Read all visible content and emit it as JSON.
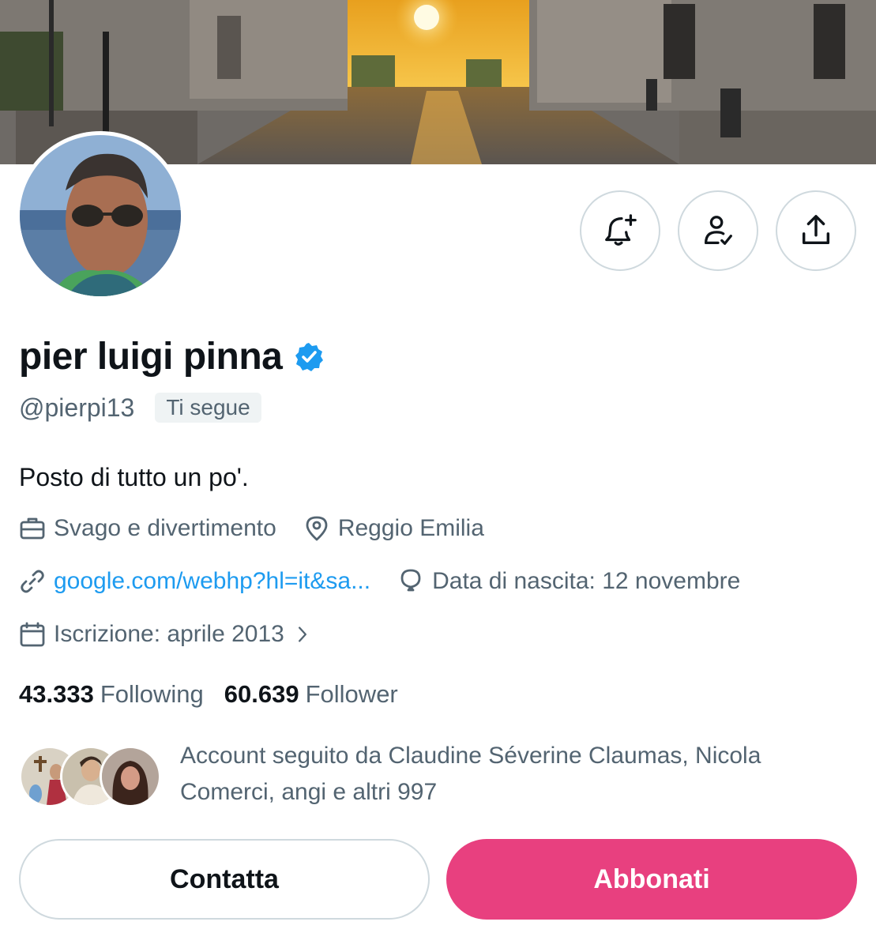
{
  "profile": {
    "display_name": "pier luigi pinna",
    "handle": "@pierpi13",
    "follows_you_badge": "Ti segue",
    "bio": "Posto di tutto un po'.",
    "category": "Svago e divertimento",
    "location": "Reggio Emilia",
    "website": "google.com/webhp?hl=it&sa...",
    "birthday": "Data di nascita: 12 novembre",
    "joined": "Iscrizione: aprile 2013"
  },
  "stats": {
    "following_count": "43.333",
    "following_label": "Following",
    "followers_count": "60.639",
    "followers_label": "Follower"
  },
  "followed_by": {
    "text": "Account seguito da Claudine Séverine Claumas, Nicola Comerci, angi e altri 997"
  },
  "actions": {
    "contact_label": "Contatta",
    "subscribe_label": "Abbonati"
  },
  "icons": {
    "notifications": "bell-plus-icon",
    "following_status": "person-check-icon",
    "share": "share-upload-icon",
    "verified": "verified-badge-icon",
    "category": "briefcase-icon",
    "location": "location-pin-icon",
    "website": "link-icon",
    "birthday": "balloon-icon",
    "joined": "calendar-icon",
    "joined_more": "chevron-right-icon"
  },
  "colors": {
    "accent_link": "#1d9bf0",
    "subscribe_button": "#e8407f",
    "text_primary": "#0f1419",
    "text_secondary": "#536471"
  }
}
